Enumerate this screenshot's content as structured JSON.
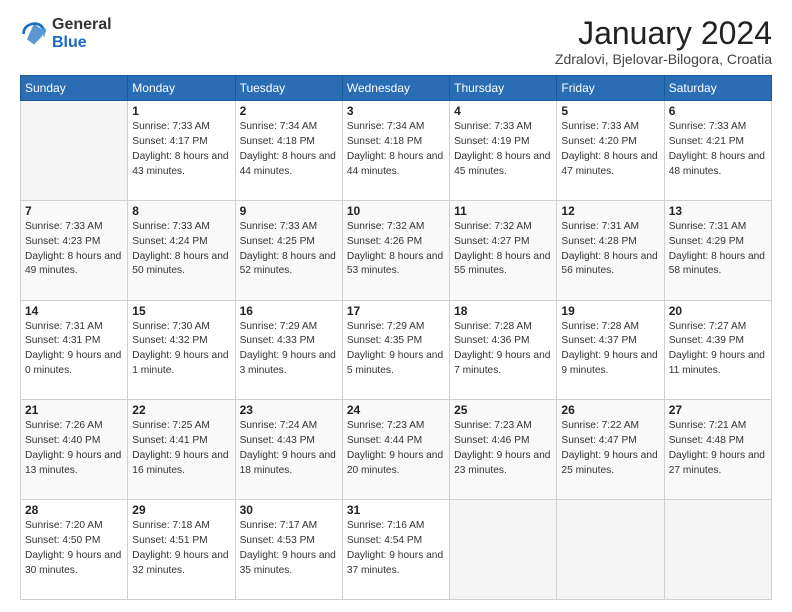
{
  "logo": {
    "general": "General",
    "blue": "Blue"
  },
  "header": {
    "title": "January 2024",
    "location": "Zdralovi, Bjelovar-Bilogora, Croatia"
  },
  "weekdays": [
    "Sunday",
    "Monday",
    "Tuesday",
    "Wednesday",
    "Thursday",
    "Friday",
    "Saturday"
  ],
  "weeks": [
    [
      {
        "day": "",
        "empty": true
      },
      {
        "day": "1",
        "sunrise": "Sunrise: 7:33 AM",
        "sunset": "Sunset: 4:17 PM",
        "daylight": "Daylight: 8 hours and 43 minutes."
      },
      {
        "day": "2",
        "sunrise": "Sunrise: 7:34 AM",
        "sunset": "Sunset: 4:18 PM",
        "daylight": "Daylight: 8 hours and 44 minutes."
      },
      {
        "day": "3",
        "sunrise": "Sunrise: 7:34 AM",
        "sunset": "Sunset: 4:18 PM",
        "daylight": "Daylight: 8 hours and 44 minutes."
      },
      {
        "day": "4",
        "sunrise": "Sunrise: 7:33 AM",
        "sunset": "Sunset: 4:19 PM",
        "daylight": "Daylight: 8 hours and 45 minutes."
      },
      {
        "day": "5",
        "sunrise": "Sunrise: 7:33 AM",
        "sunset": "Sunset: 4:20 PM",
        "daylight": "Daylight: 8 hours and 47 minutes."
      },
      {
        "day": "6",
        "sunrise": "Sunrise: 7:33 AM",
        "sunset": "Sunset: 4:21 PM",
        "daylight": "Daylight: 8 hours and 48 minutes."
      }
    ],
    [
      {
        "day": "7",
        "sunrise": "Sunrise: 7:33 AM",
        "sunset": "Sunset: 4:23 PM",
        "daylight": "Daylight: 8 hours and 49 minutes."
      },
      {
        "day": "8",
        "sunrise": "Sunrise: 7:33 AM",
        "sunset": "Sunset: 4:24 PM",
        "daylight": "Daylight: 8 hours and 50 minutes."
      },
      {
        "day": "9",
        "sunrise": "Sunrise: 7:33 AM",
        "sunset": "Sunset: 4:25 PM",
        "daylight": "Daylight: 8 hours and 52 minutes."
      },
      {
        "day": "10",
        "sunrise": "Sunrise: 7:32 AM",
        "sunset": "Sunset: 4:26 PM",
        "daylight": "Daylight: 8 hours and 53 minutes."
      },
      {
        "day": "11",
        "sunrise": "Sunrise: 7:32 AM",
        "sunset": "Sunset: 4:27 PM",
        "daylight": "Daylight: 8 hours and 55 minutes."
      },
      {
        "day": "12",
        "sunrise": "Sunrise: 7:31 AM",
        "sunset": "Sunset: 4:28 PM",
        "daylight": "Daylight: 8 hours and 56 minutes."
      },
      {
        "day": "13",
        "sunrise": "Sunrise: 7:31 AM",
        "sunset": "Sunset: 4:29 PM",
        "daylight": "Daylight: 8 hours and 58 minutes."
      }
    ],
    [
      {
        "day": "14",
        "sunrise": "Sunrise: 7:31 AM",
        "sunset": "Sunset: 4:31 PM",
        "daylight": "Daylight: 9 hours and 0 minutes."
      },
      {
        "day": "15",
        "sunrise": "Sunrise: 7:30 AM",
        "sunset": "Sunset: 4:32 PM",
        "daylight": "Daylight: 9 hours and 1 minute."
      },
      {
        "day": "16",
        "sunrise": "Sunrise: 7:29 AM",
        "sunset": "Sunset: 4:33 PM",
        "daylight": "Daylight: 9 hours and 3 minutes."
      },
      {
        "day": "17",
        "sunrise": "Sunrise: 7:29 AM",
        "sunset": "Sunset: 4:35 PM",
        "daylight": "Daylight: 9 hours and 5 minutes."
      },
      {
        "day": "18",
        "sunrise": "Sunrise: 7:28 AM",
        "sunset": "Sunset: 4:36 PM",
        "daylight": "Daylight: 9 hours and 7 minutes."
      },
      {
        "day": "19",
        "sunrise": "Sunrise: 7:28 AM",
        "sunset": "Sunset: 4:37 PM",
        "daylight": "Daylight: 9 hours and 9 minutes."
      },
      {
        "day": "20",
        "sunrise": "Sunrise: 7:27 AM",
        "sunset": "Sunset: 4:39 PM",
        "daylight": "Daylight: 9 hours and 11 minutes."
      }
    ],
    [
      {
        "day": "21",
        "sunrise": "Sunrise: 7:26 AM",
        "sunset": "Sunset: 4:40 PM",
        "daylight": "Daylight: 9 hours and 13 minutes."
      },
      {
        "day": "22",
        "sunrise": "Sunrise: 7:25 AM",
        "sunset": "Sunset: 4:41 PM",
        "daylight": "Daylight: 9 hours and 16 minutes."
      },
      {
        "day": "23",
        "sunrise": "Sunrise: 7:24 AM",
        "sunset": "Sunset: 4:43 PM",
        "daylight": "Daylight: 9 hours and 18 minutes."
      },
      {
        "day": "24",
        "sunrise": "Sunrise: 7:23 AM",
        "sunset": "Sunset: 4:44 PM",
        "daylight": "Daylight: 9 hours and 20 minutes."
      },
      {
        "day": "25",
        "sunrise": "Sunrise: 7:23 AM",
        "sunset": "Sunset: 4:46 PM",
        "daylight": "Daylight: 9 hours and 23 minutes."
      },
      {
        "day": "26",
        "sunrise": "Sunrise: 7:22 AM",
        "sunset": "Sunset: 4:47 PM",
        "daylight": "Daylight: 9 hours and 25 minutes."
      },
      {
        "day": "27",
        "sunrise": "Sunrise: 7:21 AM",
        "sunset": "Sunset: 4:48 PM",
        "daylight": "Daylight: 9 hours and 27 minutes."
      }
    ],
    [
      {
        "day": "28",
        "sunrise": "Sunrise: 7:20 AM",
        "sunset": "Sunset: 4:50 PM",
        "daylight": "Daylight: 9 hours and 30 minutes."
      },
      {
        "day": "29",
        "sunrise": "Sunrise: 7:18 AM",
        "sunset": "Sunset: 4:51 PM",
        "daylight": "Daylight: 9 hours and 32 minutes."
      },
      {
        "day": "30",
        "sunrise": "Sunrise: 7:17 AM",
        "sunset": "Sunset: 4:53 PM",
        "daylight": "Daylight: 9 hours and 35 minutes."
      },
      {
        "day": "31",
        "sunrise": "Sunrise: 7:16 AM",
        "sunset": "Sunset: 4:54 PM",
        "daylight": "Daylight: 9 hours and 37 minutes."
      },
      {
        "day": "",
        "empty": true
      },
      {
        "day": "",
        "empty": true
      },
      {
        "day": "",
        "empty": true
      }
    ]
  ]
}
